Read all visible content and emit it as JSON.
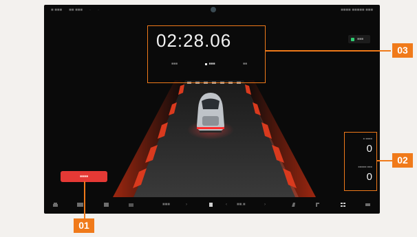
{
  "statusbar": {
    "left_a": "■ ■■■",
    "left_b": "■■ ■■■",
    "right": "■■■■ ■■■■■ ■■■"
  },
  "toggle": {
    "label": "■■■"
  },
  "timer": {
    "value": "02:28.06"
  },
  "laps": {
    "left": "■■■",
    "mid": "■■■",
    "right": "■■"
  },
  "stats": {
    "label_top": "■ ■■■■",
    "value_top": "0",
    "label_bottom": "■■■■■ ■■■",
    "value_bottom": "0"
  },
  "start_button": {
    "label": "■■■■"
  },
  "bottombar": {
    "left_value": "■■■",
    "right_value": "■■.■"
  },
  "callouts": {
    "c01": "01",
    "c02": "02",
    "c03": "03"
  },
  "colors": {
    "accent": "#f07a1a",
    "start": "#e53935",
    "track_marker": "#d93a1e"
  }
}
